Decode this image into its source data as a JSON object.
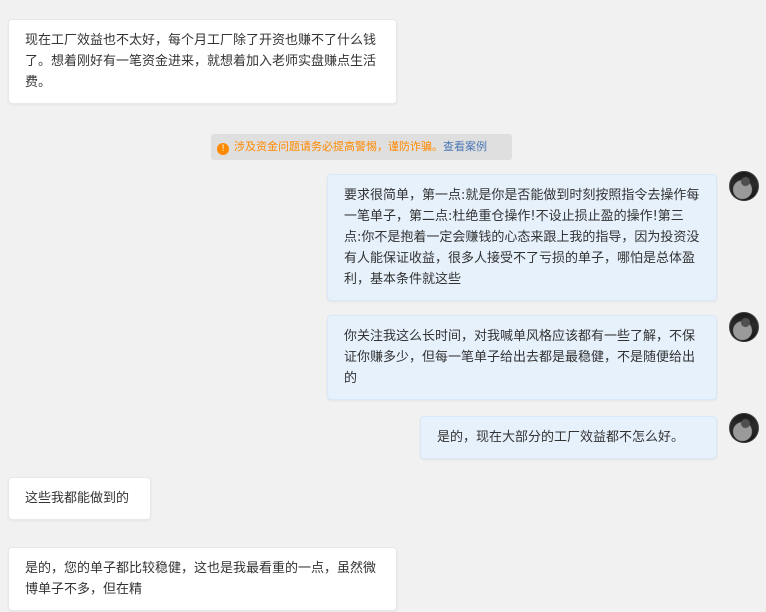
{
  "messages": [
    {
      "side": "left",
      "text": "现在工厂效益也不太好，每个月工厂除了开资也赚不了什么钱了。想着刚好有一笔资金进来，就想着加入老师实盘赚点生活费。"
    },
    {
      "side": "right",
      "text": "要求很简单，第一点:就是你是否能做到时刻按照指令去操作每一笔单子，第二点:杜绝重仓操作!不设止损止盈的操作!第三点:你不是抱着一定会赚钱的心态来跟上我的指导，因为投资没有人能保证收益，很多人接受不了亏损的单子，哪怕是总体盈利，基本条件就这些"
    },
    {
      "side": "right",
      "text": "你关注我这么长时间，对我喊单风格应该都有一些了解，不保证你赚多少，但每一笔单子给出去都是最稳健，不是随便给出的"
    },
    {
      "side": "right",
      "text": "是的，现在大部分的工厂效益都不怎么好。"
    },
    {
      "side": "left",
      "text": "这些我都能做到的"
    },
    {
      "side": "left",
      "text": "是的，您的单子都比较稳健，这也是我最看重的一点，虽然微博单子不多，但在精"
    }
  ],
  "notice": {
    "icon": "!",
    "text": "涉及资金问题请务必提高警惕，谨防诈骗。",
    "link": "查看案例"
  },
  "colors": {
    "background": "#f1f1f1",
    "bubble_left": "#ffffff",
    "bubble_right": "#e6f1fc",
    "notice_text": "#ff8a00",
    "notice_link": "#4b77b5"
  }
}
